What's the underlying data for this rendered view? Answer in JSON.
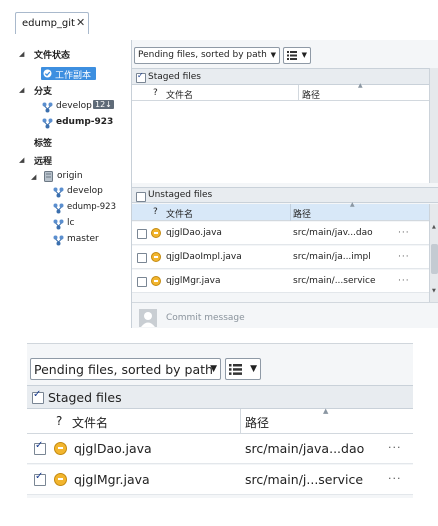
{
  "colors": {
    "selection": "#3d8fe0",
    "section_header": "#e8ecf0",
    "file_modified_icon": "#f2b52e",
    "remote_branch_icon": "#5b8fcf"
  },
  "tab": {
    "label": "edump_git",
    "close": "✕"
  },
  "sidebar": {
    "file_status": "文件状态",
    "working_copy": "工作副本",
    "branches": {
      "header": "分支",
      "items": [
        {
          "label": "develop",
          "badge": "12↓",
          "bold": false
        },
        {
          "label": "edump-923",
          "badge": "",
          "bold": true
        }
      ]
    },
    "tags": "标签",
    "remotes": {
      "header": "远程",
      "remote": "origin",
      "items": [
        "develop",
        "edump-923",
        "lc",
        "master"
      ]
    }
  },
  "toolbar": {
    "sort_select": "Pending files, sorted by path",
    "view_icon": "list-view-icon"
  },
  "staged": {
    "label": "Staged files",
    "checked": true,
    "columns": {
      "status": "?",
      "name": "文件名",
      "path": "路径"
    },
    "files": []
  },
  "unstaged": {
    "label": "Unstaged files",
    "checked": false,
    "columns": {
      "status": "?",
      "name": "文件名",
      "path": "路径"
    },
    "files": [
      {
        "name": "qjglDao.java",
        "path": "src/main/jav...dao",
        "more": "···"
      },
      {
        "name": "qjglDaoImpl.java",
        "path": "src/main/ja...impl",
        "more": "···"
      },
      {
        "name": "qjglMgr.java",
        "path": "src/main/...service",
        "more": "···"
      }
    ]
  },
  "commit": {
    "placeholder": "Commit message"
  },
  "zoomed": {
    "sort_select": "Pending files, sorted by path",
    "staged_label": "Staged files",
    "columns": {
      "status": "?",
      "name": "文件名",
      "path": "路径"
    },
    "files": [
      {
        "name": "qjglDao.java",
        "path": "src/main/java...dao",
        "more": "···"
      },
      {
        "name": "qjglMgr.java",
        "path": "src/main/j...service",
        "more": "···"
      }
    ]
  }
}
